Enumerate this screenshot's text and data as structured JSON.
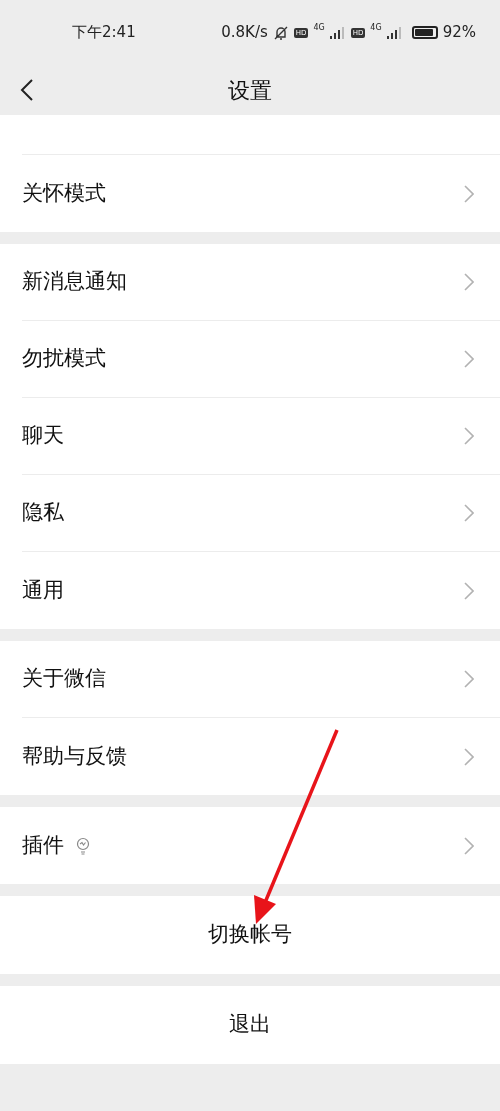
{
  "status_bar": {
    "time": "下午2:41",
    "speed": "0.8K/s",
    "sim1_badge": "HD",
    "sim1_network": "4G",
    "sim2_badge": "HD",
    "sim2_network": "4G",
    "battery": "92%"
  },
  "header": {
    "title": "设置"
  },
  "sections": [
    {
      "items": [
        {
          "kind": "cut"
        },
        {
          "kind": "nav",
          "label": "关怀模式",
          "has_icon": false
        }
      ]
    },
    {
      "items": [
        {
          "kind": "nav",
          "label": "新消息通知",
          "has_icon": false
        },
        {
          "kind": "nav",
          "label": "勿扰模式",
          "has_icon": false
        },
        {
          "kind": "nav",
          "label": "聊天",
          "has_icon": false
        },
        {
          "kind": "nav",
          "label": "隐私",
          "has_icon": false
        },
        {
          "kind": "nav",
          "label": "通用",
          "has_icon": false
        }
      ]
    },
    {
      "items": [
        {
          "kind": "nav",
          "label": "关于微信",
          "has_icon": false
        },
        {
          "kind": "nav",
          "label": "帮助与反馈",
          "has_icon": false
        }
      ]
    },
    {
      "items": [
        {
          "kind": "nav",
          "label": "插件",
          "has_icon": true
        }
      ]
    },
    {
      "items": [
        {
          "kind": "action",
          "label": "切换帐号"
        }
      ]
    },
    {
      "items": [
        {
          "kind": "action",
          "label": "退出"
        }
      ]
    }
  ]
}
